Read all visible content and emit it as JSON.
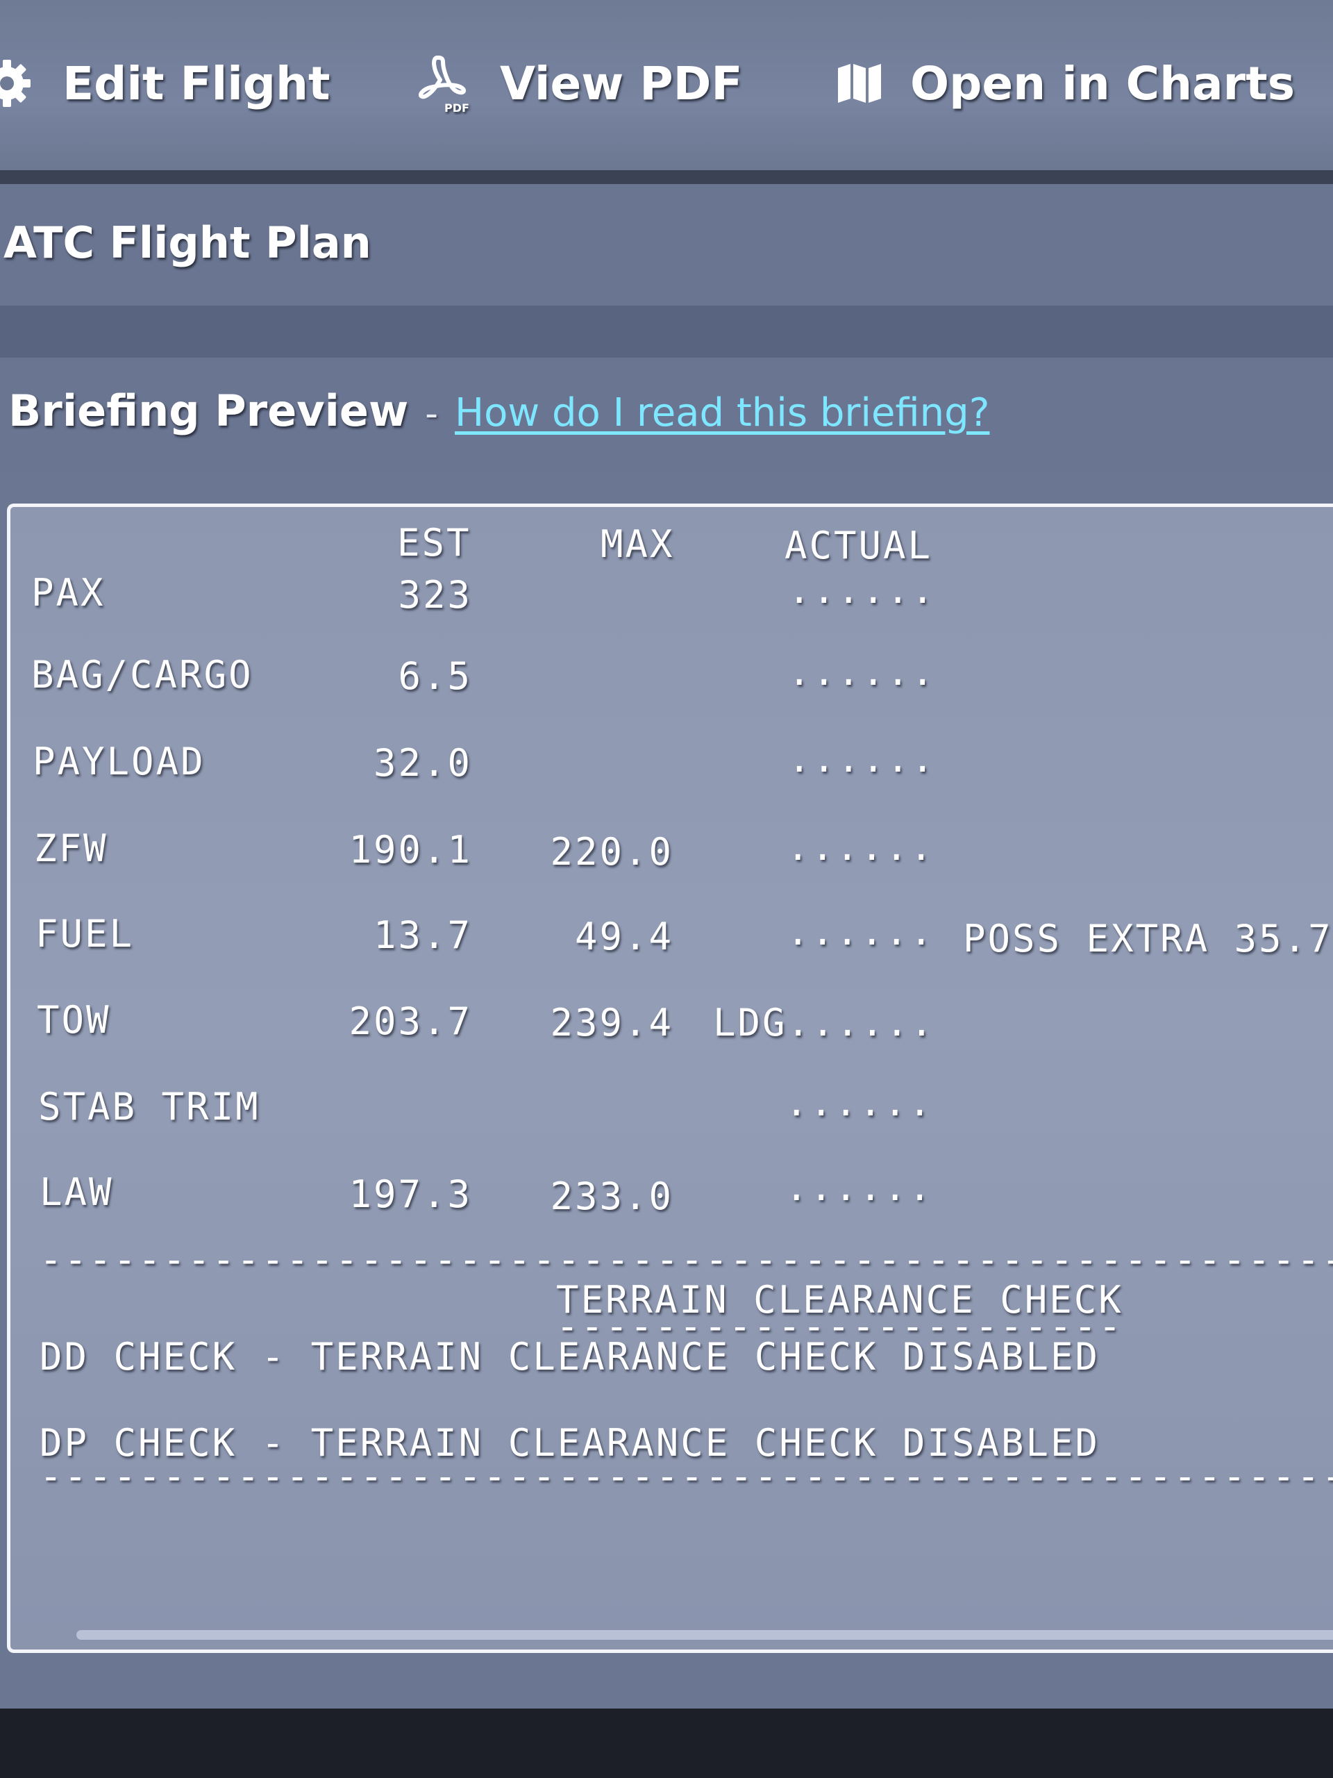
{
  "toolbar": {
    "edit_flight": "Edit Flight",
    "view_pdf": "View PDF",
    "pdf_icon_text": "PDF",
    "open_in_charts": "Open in Charts"
  },
  "atc_flight_plan": {
    "title": "ATC Flight Plan"
  },
  "briefing_preview": {
    "title": "Briefing Preview",
    "separator": "-",
    "help_link": "How do I read this briefing?"
  },
  "briefing": {
    "headers": {
      "est": "EST",
      "max": "MAX",
      "actual": "ACTUAL"
    },
    "rows": [
      {
        "label": "PAX",
        "est": "323",
        "max": "",
        "actual": "......",
        "note": ""
      },
      {
        "label": "BAG/CARGO",
        "est": "6.5",
        "max": "",
        "actual": "......",
        "note": ""
      },
      {
        "label": "PAYLOAD",
        "est": "32.0",
        "max": "",
        "actual": "......",
        "note": ""
      },
      {
        "label": "ZFW",
        "est": "190.1",
        "max": "220.0",
        "actual": "......",
        "note": ""
      },
      {
        "label": "FUEL",
        "est": "13.7",
        "max": "49.4",
        "actual": "......",
        "note": "POSS EXTRA 35.7"
      },
      {
        "label": "TOW",
        "est": "203.7",
        "max": "239.4",
        "actual": "LDG......",
        "note": ""
      },
      {
        "label": "STAB TRIM",
        "est": "",
        "max": "",
        "actual": "......",
        "note": ""
      },
      {
        "label": "LAW",
        "est": "197.3",
        "max": "233.0",
        "actual": "......",
        "note": ""
      }
    ],
    "divider": "------------------------------------------------------------",
    "terrain_heading": "TERRAIN CLEARANCE CHECK",
    "terrain_underline": "-----------------------",
    "dd_check": "DD CHECK - TERRAIN CLEARANCE CHECK DISABLED",
    "dp_check": "DP CHECK - TERRAIN CLEARANCE CHECK DISABLED"
  }
}
